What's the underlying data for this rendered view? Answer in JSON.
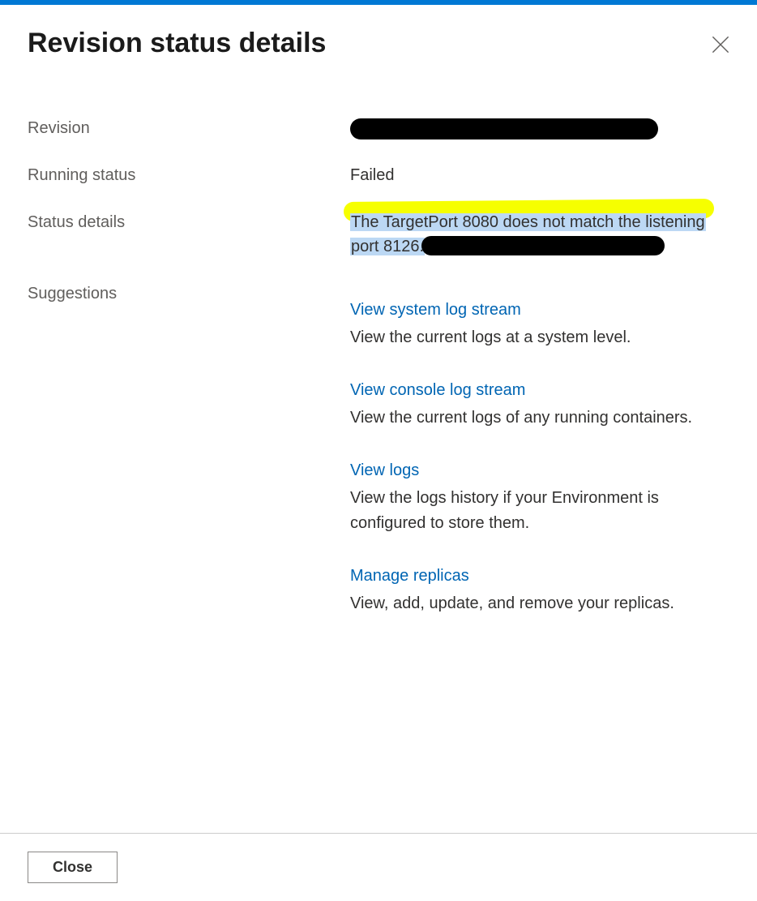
{
  "header": {
    "title": "Revision status details"
  },
  "labels": {
    "revision": "Revision",
    "running_status": "Running status",
    "status_details": "Status details",
    "suggestions": "Suggestions"
  },
  "values": {
    "running_status": "Failed",
    "status_details_line1": "The TargetPort 8080 does not match the listening",
    "status_details_line2": "port 8126."
  },
  "suggestions": [
    {
      "link": "View system log stream",
      "desc": "View the current logs at a system level."
    },
    {
      "link": "View console log stream",
      "desc": "View the current logs of any running containers."
    },
    {
      "link": "View logs",
      "desc": "View the logs history if your Environment is configured to store them."
    },
    {
      "link": "Manage replicas",
      "desc": "View, add, update, and remove your replicas."
    }
  ],
  "footer": {
    "close_label": "Close"
  }
}
